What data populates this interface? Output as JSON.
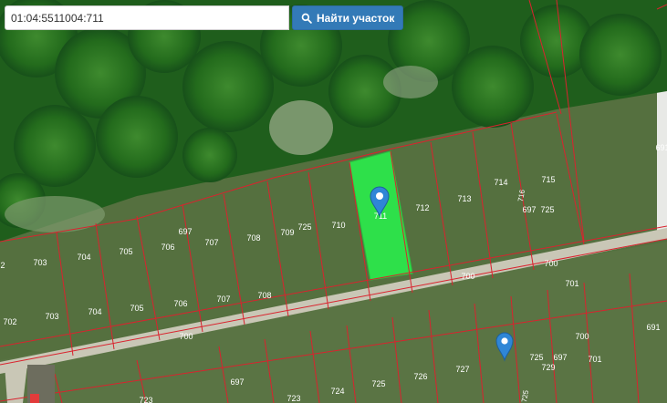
{
  "search": {
    "value": "01:04:5511004:711",
    "button_label": "Найти участок"
  },
  "map": {
    "boundary_color": "#d9232e",
    "highlight_color": "#2ee04a",
    "marker_color": "#2f86d6",
    "road_color": "#c9c7b6",
    "icons": [
      "map-marker-icon",
      "search-icon"
    ],
    "highlight_label": "711",
    "parcel_labels": {
      "upper_row": [
        "703",
        "704",
        "705",
        "706",
        "697",
        "707",
        "708",
        "709",
        "725",
        "710",
        "712",
        "713",
        "714",
        "715",
        "716",
        "697",
        "725"
      ],
      "road_row": [
        "702",
        "703",
        "704",
        "705",
        "706",
        "707",
        "708"
      ],
      "road": [
        "700",
        "700",
        "700",
        "700"
      ],
      "right": [
        "701",
        "701",
        "691",
        "691"
      ],
      "lower_row": [
        "697",
        "723",
        "724",
        "725",
        "726",
        "727",
        "725",
        "697",
        "729",
        "723",
        "725"
      ],
      "left_edge": [
        "2"
      ]
    }
  }
}
